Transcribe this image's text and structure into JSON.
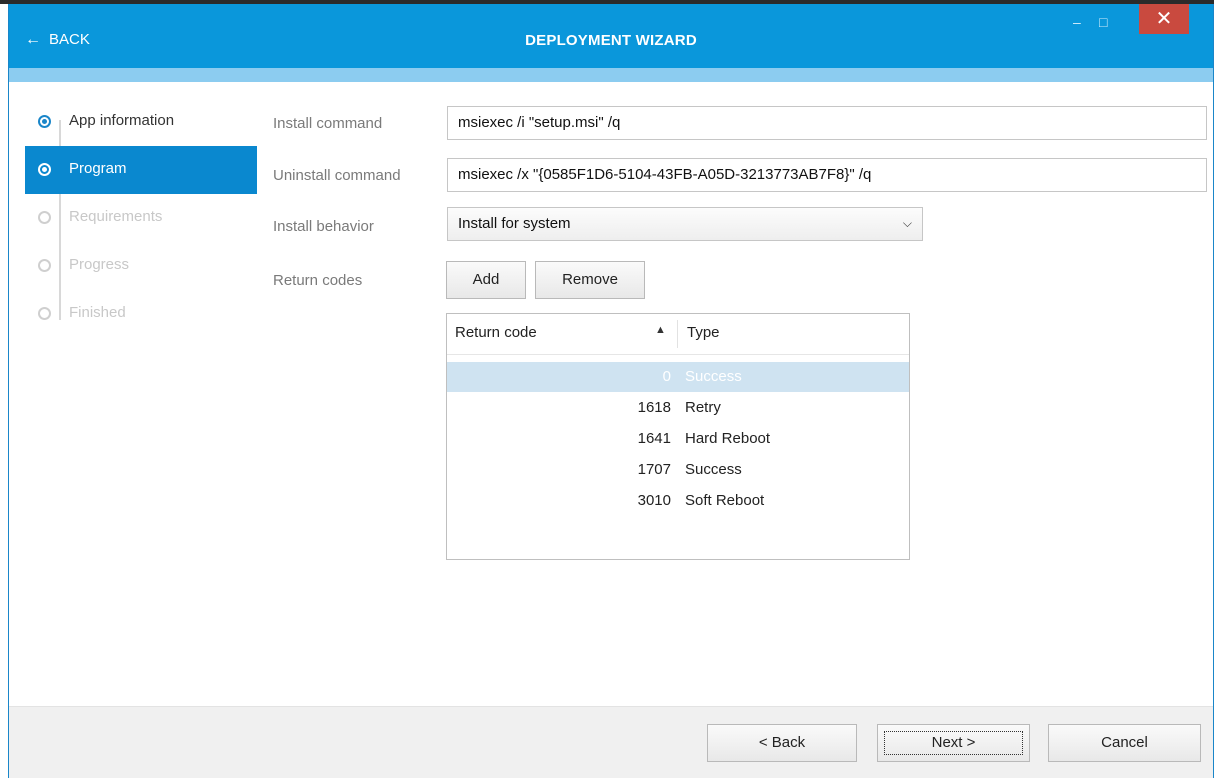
{
  "titlebar": {
    "back_label": "BACK",
    "title": "DEPLOYMENT WIZARD",
    "minimize_glyph": "–",
    "maximize_glyph": "□",
    "close_glyph": "✕"
  },
  "steps": [
    {
      "label": "App information",
      "state": "done"
    },
    {
      "label": "Program",
      "state": "active"
    },
    {
      "label": "Requirements",
      "state": "pending"
    },
    {
      "label": "Progress",
      "state": "pending"
    },
    {
      "label": "Finished",
      "state": "pending"
    }
  ],
  "form": {
    "install_command_label": "Install command",
    "install_command_value": "msiexec /i \"setup.msi\" /q",
    "uninstall_command_label": "Uninstall command",
    "uninstall_command_value": "msiexec /x \"{0585F1D6-5104-43FB-A05D-3213773AB7F8}\" /q",
    "install_behavior_label": "Install behavior",
    "install_behavior_value": "Install for system",
    "return_codes_label": "Return codes",
    "add_label": "Add",
    "remove_label": "Remove"
  },
  "return_codes": {
    "columns": [
      "Return code",
      "Type"
    ],
    "sort_indicator": "▲",
    "rows": [
      {
        "code": "0",
        "type": "Success",
        "selected": true
      },
      {
        "code": "1618",
        "type": "Retry",
        "selected": false
      },
      {
        "code": "1641",
        "type": "Hard Reboot",
        "selected": false
      },
      {
        "code": "1707",
        "type": "Success",
        "selected": false
      },
      {
        "code": "3010",
        "type": "Soft Reboot",
        "selected": false
      }
    ]
  },
  "footer": {
    "back_label": "< Back",
    "next_label": "Next >",
    "cancel_label": "Cancel"
  }
}
